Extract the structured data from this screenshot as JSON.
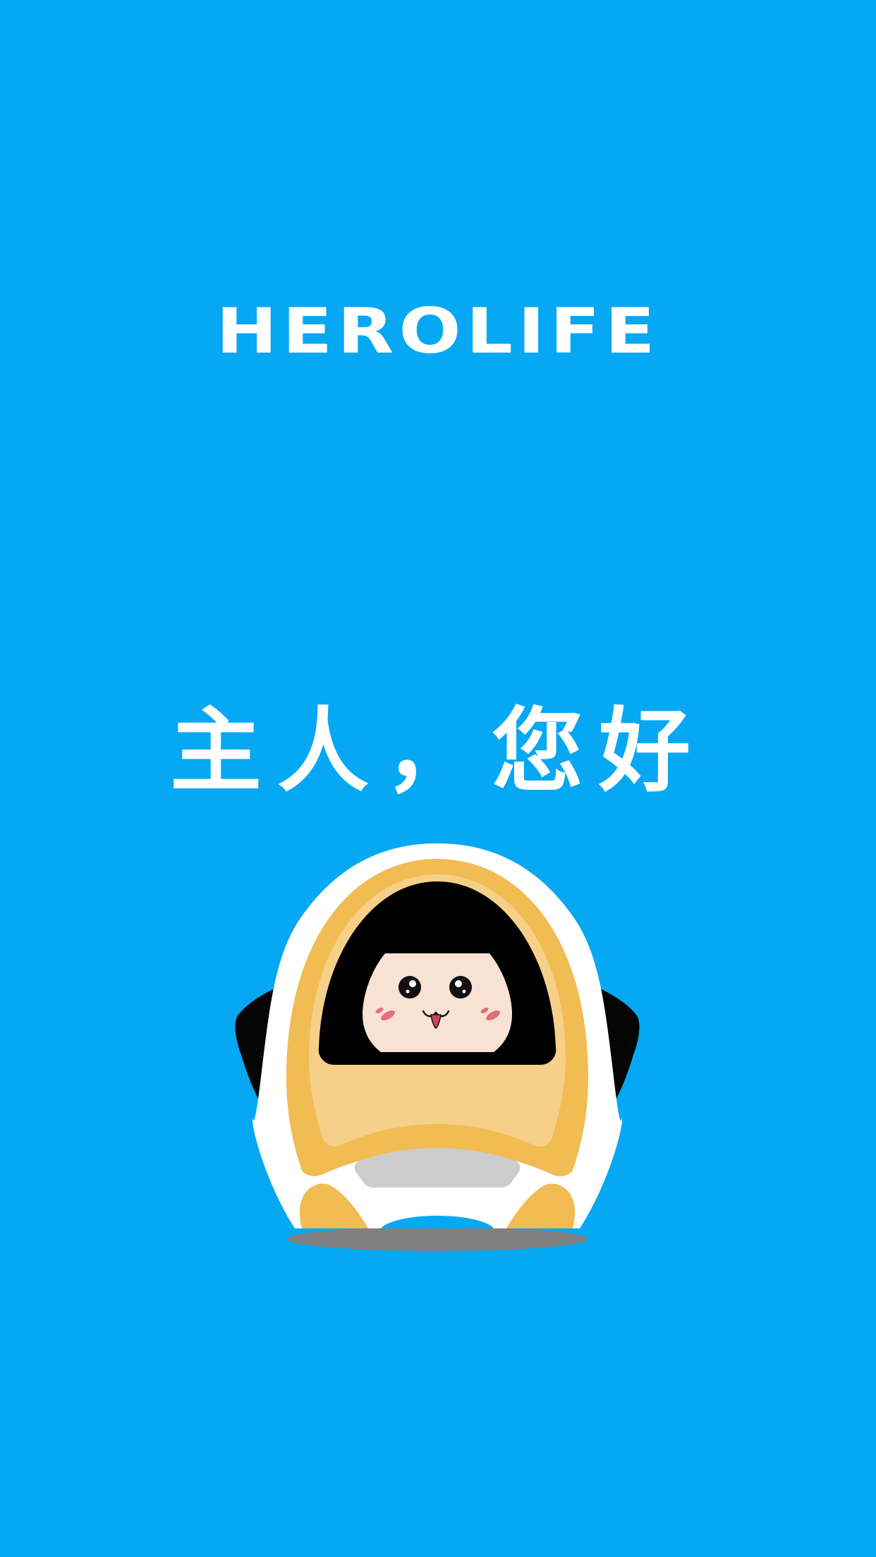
{
  "splash": {
    "brand": "HEROLIFE",
    "greeting": "主人，您好",
    "mascot_icon": "robot-mascot"
  },
  "colors": {
    "background": "#06a8f3",
    "text": "#ffffff",
    "robot_yellow": "#f1bc52",
    "robot_light_yellow": "#f6d088",
    "face": "#f8e2d4",
    "shadow": "#808080"
  }
}
